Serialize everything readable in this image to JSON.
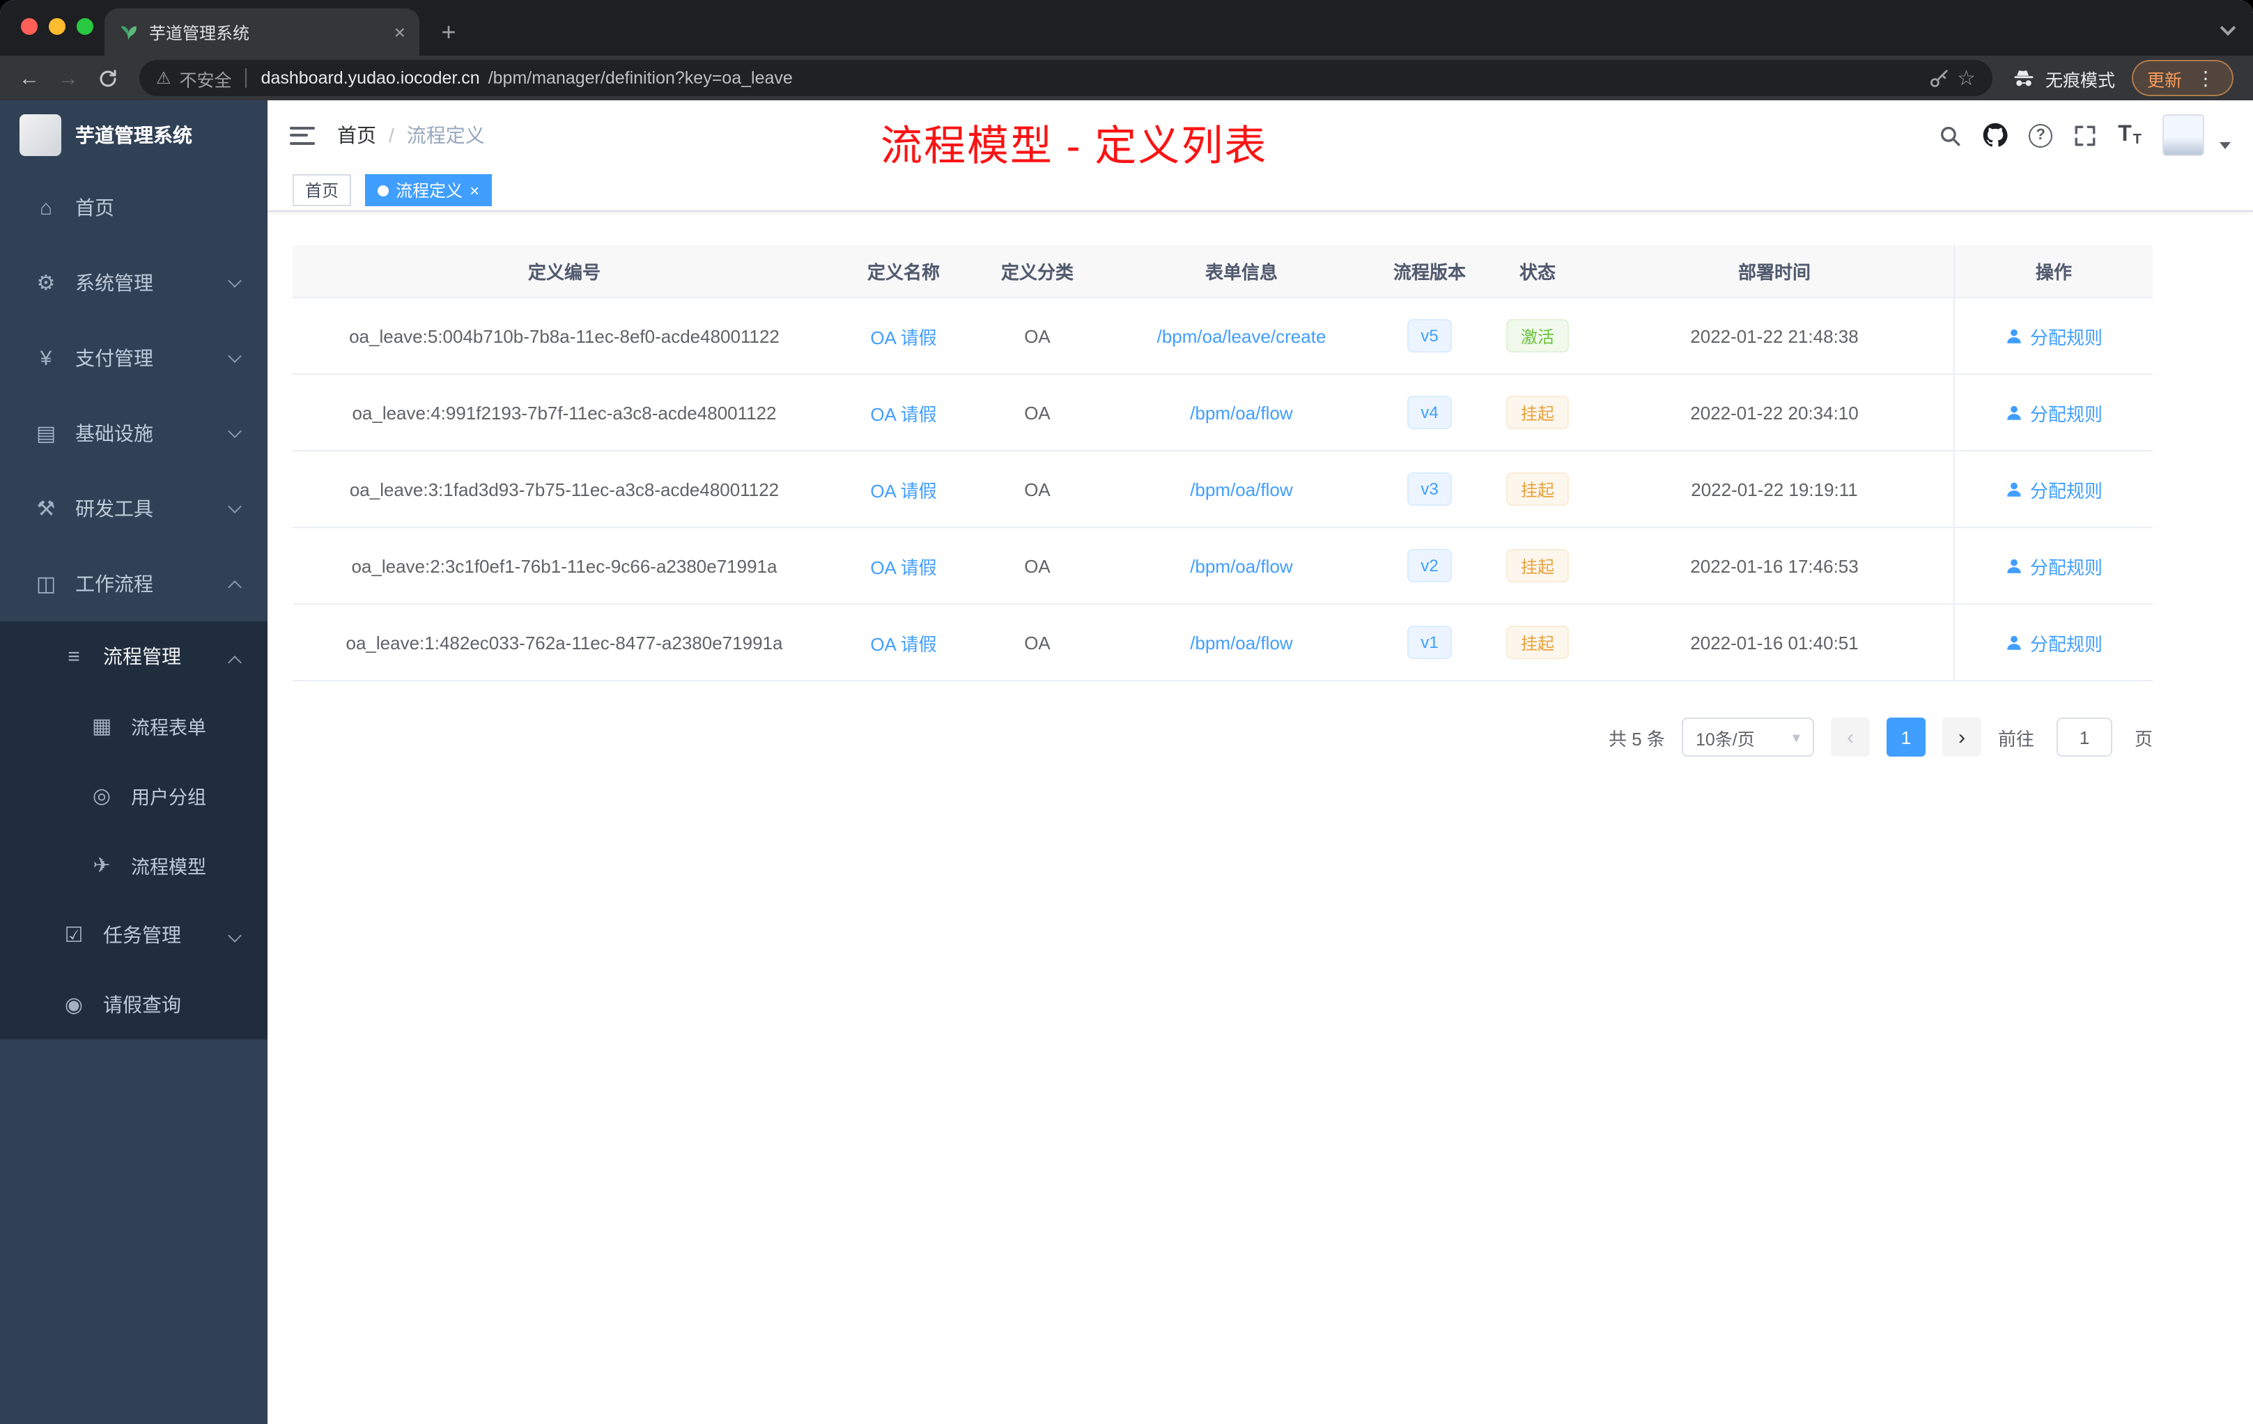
{
  "colors": {
    "primary": "#409eff",
    "success": "#67c23a",
    "warning": "#e6a23c",
    "sidebar": "#304156",
    "submenu": "#1f2d3d"
  },
  "browser": {
    "tab": {
      "title": "芋道管理系统",
      "close": "×",
      "new_tab": "+"
    },
    "security_label": "不安全",
    "url_host": "dashboard.yudao.iocoder.cn",
    "url_path": "/bpm/manager/definition?key=oa_leave",
    "incognito_label": "无痕模式",
    "update_label": "更新",
    "menu_icon": "⋮",
    "back": "←",
    "forward": "→",
    "star": "☆",
    "warning": "⚠"
  },
  "sidebar": {
    "app_title": "芋道管理系统",
    "menu": [
      {
        "label": "首页",
        "icon": "⌂",
        "chevron": ""
      },
      {
        "label": "系统管理",
        "icon": "⚙",
        "chevron": "down"
      },
      {
        "label": "支付管理",
        "icon": "¥",
        "chevron": "down"
      },
      {
        "label": "基础设施",
        "icon": "▤",
        "chevron": "down"
      },
      {
        "label": "研发工具",
        "icon": "⚒",
        "chevron": "down"
      },
      {
        "label": "工作流程",
        "icon": "◫",
        "chevron": "up"
      }
    ],
    "submenu": {
      "label": "流程管理",
      "icon": "≡",
      "chevron": "up",
      "children": [
        {
          "label": "流程表单",
          "icon": "▦"
        },
        {
          "label": "用户分组",
          "icon": "◎"
        },
        {
          "label": "流程模型",
          "icon": "✈"
        }
      ]
    },
    "menu_lower": [
      {
        "label": "任务管理",
        "icon": "☑",
        "chevron": "down"
      },
      {
        "label": "请假查询",
        "icon": "◉",
        "chevron": ""
      }
    ]
  },
  "header": {
    "breadcrumb_home": "首页",
    "breadcrumb_sep": "/",
    "breadcrumb_current": "流程定义",
    "annotation": "流程模型 - 定义列表"
  },
  "tags": {
    "home": {
      "label": "首页"
    },
    "current": {
      "label": "流程定义",
      "close": "×"
    }
  },
  "table": {
    "columns": [
      "定义编号",
      "定义名称",
      "定义分类",
      "表单信息",
      "流程版本",
      "状态",
      "部署时间",
      "操作"
    ],
    "rows": [
      {
        "id": "oa_leave:5:004b710b-7b8a-11ec-8ef0-acde48001122",
        "name": "OA 请假",
        "category": "OA",
        "form": "/bpm/oa/leave/create",
        "version": "v5",
        "status": "激活",
        "status_type": "success",
        "time": "2022-01-22 21:48:38",
        "action": "分配规则"
      },
      {
        "id": "oa_leave:4:991f2193-7b7f-11ec-a3c8-acde48001122",
        "name": "OA 请假",
        "category": "OA",
        "form": "/bpm/oa/flow",
        "version": "v4",
        "status": "挂起",
        "status_type": "warning",
        "time": "2022-01-22 20:34:10",
        "action": "分配规则"
      },
      {
        "id": "oa_leave:3:1fad3d93-7b75-11ec-a3c8-acde48001122",
        "name": "OA 请假",
        "category": "OA",
        "form": "/bpm/oa/flow",
        "version": "v3",
        "status": "挂起",
        "status_type": "warning",
        "time": "2022-01-22 19:19:11",
        "action": "分配规则"
      },
      {
        "id": "oa_leave:2:3c1f0ef1-76b1-11ec-9c66-a2380e71991a",
        "name": "OA 请假",
        "category": "OA",
        "form": "/bpm/oa/flow",
        "version": "v2",
        "status": "挂起",
        "status_type": "warning",
        "time": "2022-01-16 17:46:53",
        "action": "分配规则"
      },
      {
        "id": "oa_leave:1:482ec033-762a-11ec-8477-a2380e71991a",
        "name": "OA 请假",
        "category": "OA",
        "form": "/bpm/oa/flow",
        "version": "v1",
        "status": "挂起",
        "status_type": "warning",
        "time": "2022-01-16 01:40:51",
        "action": "分配规则"
      }
    ]
  },
  "pagination": {
    "total": "共 5 条",
    "page_size": "10条/页",
    "caret": "▾",
    "prev": "‹",
    "page": "1",
    "next": "›",
    "goto_label": "前往",
    "goto_value": "1",
    "goto_unit": "页"
  }
}
